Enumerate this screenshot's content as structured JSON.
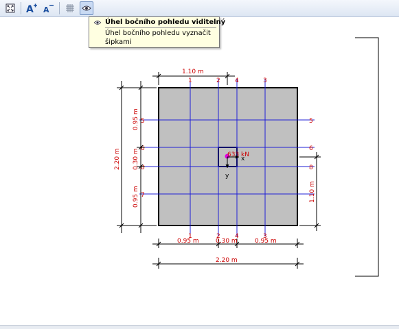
{
  "toolbar": {
    "buttons": [
      {
        "icon": "zoom-extents-icon"
      },
      {
        "icon": "font-increase-icon"
      },
      {
        "icon": "font-decrease-icon"
      },
      {
        "icon": "grid-icon"
      },
      {
        "icon": "eye-icon",
        "active": true
      }
    ]
  },
  "tooltip": {
    "title": "Úhel bočního pohledu viditelný",
    "description": "Úhel bočního pohledu vyznačit šipkami"
  },
  "drawing": {
    "dims": {
      "top": "1.10 m",
      "left_total": "2.20 m",
      "left_a": "0.95 m",
      "left_b": "0.30 m",
      "left_c": "0.95 m",
      "right": "1.10 m",
      "bottom_a": "0.95 m",
      "bottom_b": "0.30 m",
      "bottom_c": "0.95 m",
      "bottom_total": "2.20 m"
    },
    "axes": {
      "v1": "1",
      "v2": "2",
      "v4": "4",
      "v3": "3",
      "h5": "5",
      "h6": "6",
      "h8": "8",
      "h7": "7"
    },
    "load": "633 kN",
    "axis_x": "x",
    "axis_y": "y"
  },
  "colors": {
    "grid_line": "#1f1fd6",
    "dimension": "#cc0000",
    "footing_fill": "#c0c0c0",
    "load_point": "#e000e0"
  }
}
